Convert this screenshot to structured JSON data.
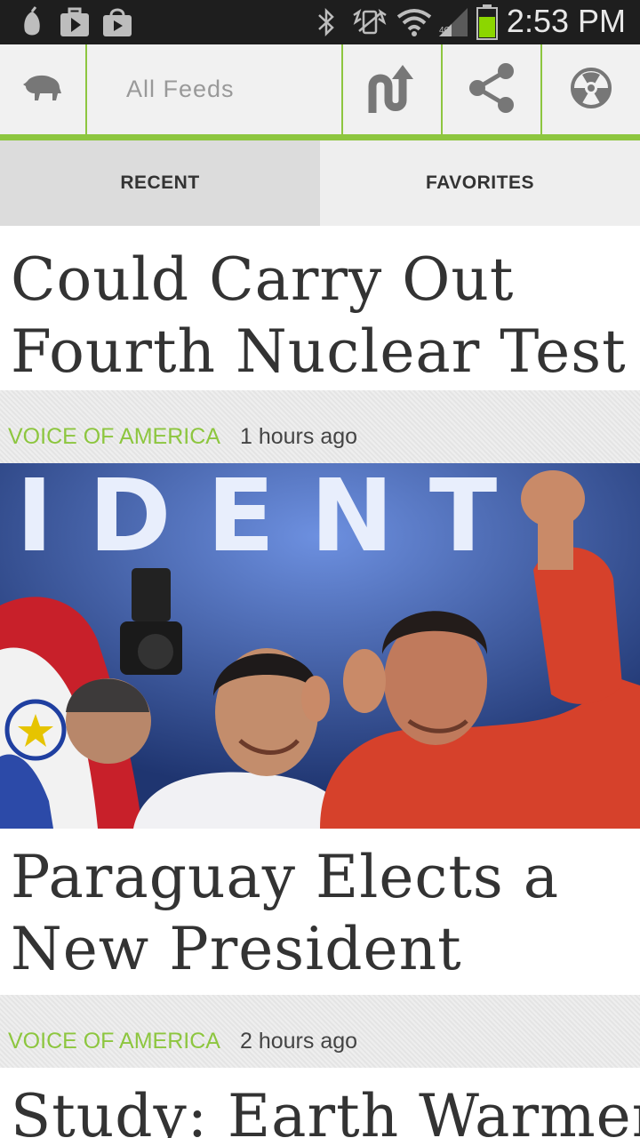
{
  "status_bar": {
    "time": "2:53 PM",
    "icons": [
      "lemon-icon",
      "play-store-icon",
      "shopping-bag-icon",
      "bluetooth-icon",
      "vibrate-icon",
      "wifi-icon",
      "signal-icon",
      "battery-icon"
    ]
  },
  "action_bar": {
    "feed_title": "All Feeds",
    "icons": [
      "buffalo-logo-icon",
      "refresh-up-icon",
      "share-icon",
      "radiation-icon"
    ],
    "accent_color": "#8dc63f"
  },
  "tabs": [
    {
      "label": "RECENT",
      "selected": true
    },
    {
      "label": "FAVORITES",
      "selected": false
    }
  ],
  "feed": {
    "items": [
      {
        "headline": "Could Carry Out Fourth Nuclear Test",
        "source": "VOICE OF AMERICA",
        "time": "1 hours ago"
      },
      {
        "headline": "Paraguay Elects a New President",
        "source": "VOICE OF AMERICA",
        "time": "2 hours ago",
        "has_image": true,
        "image_caption_text": "IDENT"
      },
      {
        "headline": "Study: Earth Warmer"
      }
    ]
  }
}
